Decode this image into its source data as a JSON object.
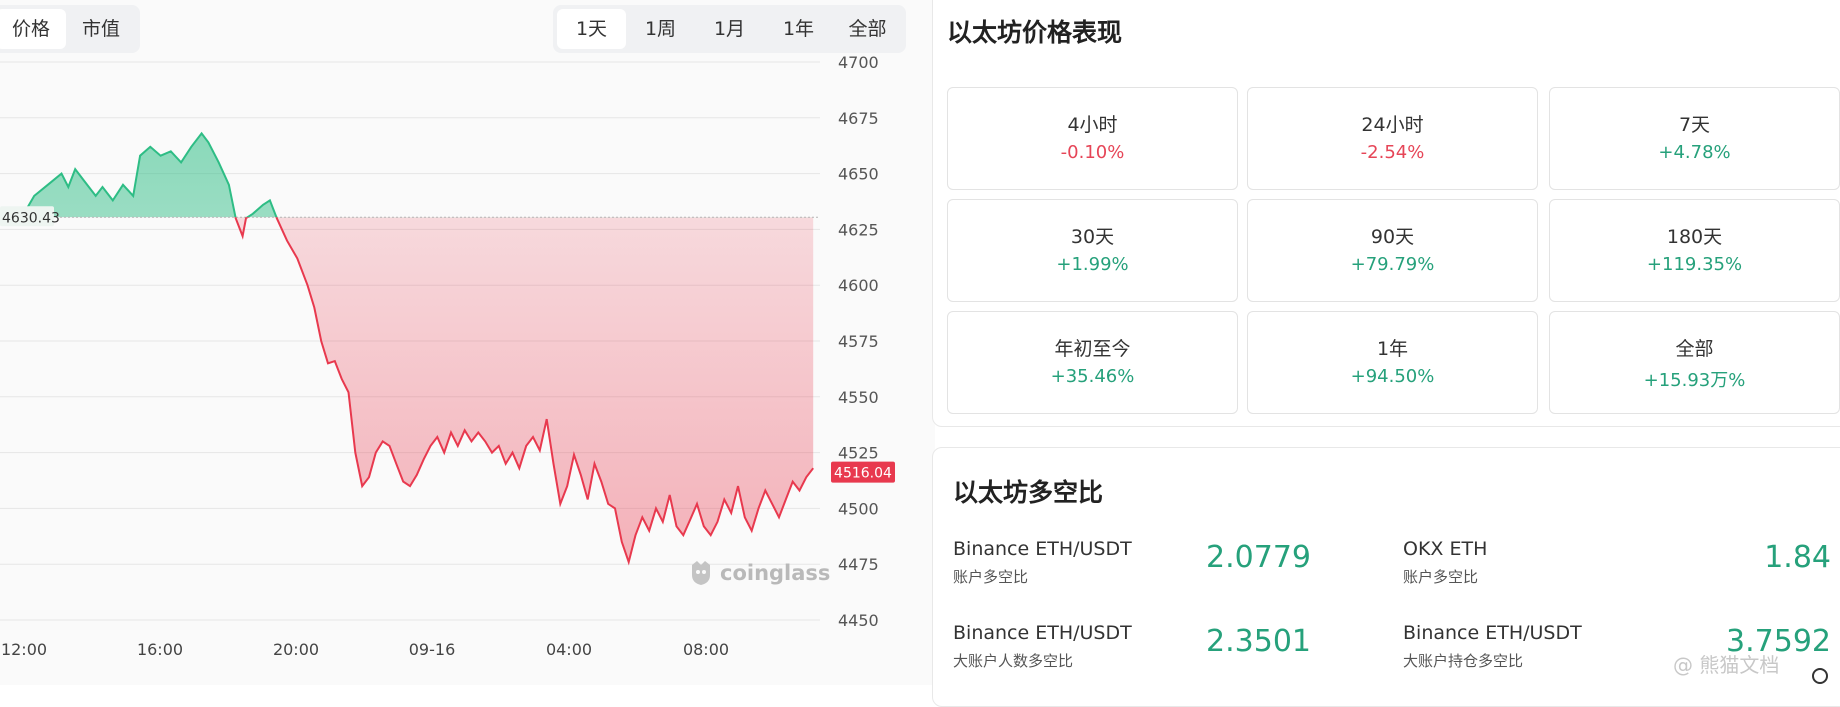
{
  "chart": {
    "metric_tabs": [
      {
        "label": "价格",
        "active": true
      },
      {
        "label": "市值",
        "active": false
      }
    ],
    "range_tabs": [
      {
        "label": "1天",
        "active": true
      },
      {
        "label": "1周",
        "active": false
      },
      {
        "label": "1月",
        "active": false
      },
      {
        "label": "1年",
        "active": false
      },
      {
        "label": "全部",
        "active": false
      }
    ],
    "watermark": "coinglass",
    "colors": {
      "up": "#2ebd85",
      "down": "#e8394e",
      "up_fill": "#bfe9d5",
      "down_fill": "#f2c1c8"
    }
  },
  "chart_data": {
    "type": "area",
    "y_ticks": [
      "4700",
      "4675",
      "4650",
      "4625",
      "4600",
      "4575",
      "4550",
      "4525",
      "4500",
      "4475",
      "4450"
    ],
    "x_ticks": [
      "12:00",
      "16:00",
      "20:00",
      "09-16",
      "04:00",
      "08:00"
    ],
    "ylim": [
      4450,
      4700
    ],
    "baseline_value": 4630.43,
    "baseline_label": "4630.43",
    "last_value": 4516.04,
    "last_label": "4516.04",
    "x_hours": [
      11,
      23
    ],
    "series": [
      {
        "values": [
          [
            11.35,
            4632
          ],
          [
            11.5,
            4640
          ],
          [
            11.7,
            4645
          ],
          [
            11.9,
            4650
          ],
          [
            12.0,
            4644
          ],
          [
            12.1,
            4652
          ],
          [
            12.25,
            4646
          ],
          [
            12.4,
            4640
          ],
          [
            12.5,
            4644
          ],
          [
            12.65,
            4638
          ],
          [
            12.8,
            4645
          ],
          [
            12.95,
            4640
          ],
          [
            13.05,
            4658
          ],
          [
            13.2,
            4662
          ],
          [
            13.35,
            4658
          ],
          [
            13.5,
            4660
          ],
          [
            13.65,
            4655
          ],
          [
            13.8,
            4662
          ],
          [
            13.95,
            4668
          ],
          [
            14.05,
            4664
          ],
          [
            14.2,
            4655
          ],
          [
            14.35,
            4645
          ],
          [
            14.45,
            4630
          ],
          [
            14.55,
            4622
          ],
          [
            14.6,
            4630
          ],
          [
            14.7,
            4632
          ],
          [
            14.85,
            4636
          ],
          [
            14.95,
            4638
          ],
          [
            15.05,
            4630
          ],
          [
            15.2,
            4620
          ],
          [
            15.35,
            4612
          ],
          [
            15.5,
            4600
          ],
          [
            15.6,
            4590
          ],
          [
            15.7,
            4575
          ],
          [
            15.8,
            4565
          ],
          [
            15.9,
            4566
          ],
          [
            16.0,
            4558
          ],
          [
            16.1,
            4552
          ],
          [
            16.2,
            4525
          ],
          [
            16.3,
            4510
          ],
          [
            16.4,
            4514
          ],
          [
            16.5,
            4525
          ],
          [
            16.6,
            4530
          ],
          [
            16.7,
            4528
          ],
          [
            16.8,
            4520
          ],
          [
            16.9,
            4512
          ],
          [
            17.0,
            4510
          ],
          [
            17.1,
            4515
          ],
          [
            17.2,
            4522
          ],
          [
            17.3,
            4528
          ],
          [
            17.4,
            4532
          ],
          [
            17.5,
            4525
          ],
          [
            17.6,
            4534
          ],
          [
            17.7,
            4528
          ],
          [
            17.8,
            4535
          ],
          [
            17.9,
            4530
          ],
          [
            18.0,
            4534
          ],
          [
            18.1,
            4530
          ],
          [
            18.2,
            4525
          ],
          [
            18.3,
            4528
          ],
          [
            18.4,
            4520
          ],
          [
            18.5,
            4525
          ],
          [
            18.6,
            4518
          ],
          [
            18.7,
            4528
          ],
          [
            18.8,
            4532
          ],
          [
            18.9,
            4526
          ],
          [
            19.0,
            4540
          ],
          [
            19.1,
            4520
          ],
          [
            19.2,
            4502
          ],
          [
            19.3,
            4510
          ],
          [
            19.4,
            4524
          ],
          [
            19.5,
            4515
          ],
          [
            19.6,
            4504
          ],
          [
            19.7,
            4520
          ],
          [
            19.8,
            4512
          ],
          [
            19.9,
            4502
          ],
          [
            20.0,
            4500
          ],
          [
            20.1,
            4485
          ],
          [
            20.2,
            4476
          ],
          [
            20.3,
            4488
          ],
          [
            20.4,
            4496
          ],
          [
            20.5,
            4490
          ],
          [
            20.6,
            4500
          ],
          [
            20.7,
            4494
          ],
          [
            20.8,
            4506
          ],
          [
            20.9,
            4492
          ],
          [
            21.0,
            4488
          ],
          [
            21.1,
            4495
          ],
          [
            21.2,
            4502
          ],
          [
            21.3,
            4492
          ],
          [
            21.4,
            4488
          ],
          [
            21.5,
            4494
          ],
          [
            21.6,
            4504
          ],
          [
            21.7,
            4498
          ],
          [
            21.8,
            4510
          ],
          [
            21.9,
            4496
          ],
          [
            22.0,
            4490
          ],
          [
            22.1,
            4500
          ],
          [
            22.2,
            4508
          ],
          [
            22.3,
            4502
          ],
          [
            22.4,
            4496
          ],
          [
            22.5,
            4504
          ],
          [
            22.6,
            4512
          ],
          [
            22.7,
            4508
          ],
          [
            22.8,
            4514
          ],
          [
            22.9,
            4518
          ]
        ]
      }
    ]
  },
  "performance": {
    "title": "以太坊价格表现",
    "tiles": [
      {
        "label": "4小时",
        "value": "-0.10%",
        "trend": "neg"
      },
      {
        "label": "24小时",
        "value": "-2.54%",
        "trend": "neg"
      },
      {
        "label": "7天",
        "value": "+4.78%",
        "trend": "pos"
      },
      {
        "label": "30天",
        "value": "+1.99%",
        "trend": "pos"
      },
      {
        "label": "90天",
        "value": "+79.79%",
        "trend": "pos"
      },
      {
        "label": "180天",
        "value": "+119.35%",
        "trend": "pos"
      },
      {
        "label": "年初至今",
        "value": "+35.46%",
        "trend": "pos"
      },
      {
        "label": "1年",
        "value": "+94.50%",
        "trend": "pos"
      },
      {
        "label": "全部",
        "value": "+15.93万%",
        "trend": "pos"
      }
    ]
  },
  "long_short": {
    "title": "以太坊多空比",
    "items": [
      {
        "name": "Binance ETH/USDT",
        "sub": "账户多空比",
        "value": "2.0779"
      },
      {
        "name": "OKX ETH",
        "sub": "账户多空比",
        "value": "1.84"
      },
      {
        "name": "Binance ETH/USDT",
        "sub": "大账户人数多空比",
        "value": "2.3501"
      },
      {
        "name": "Binance ETH/USDT",
        "sub": "大账户持仓多空比",
        "value": "3.7592"
      }
    ]
  },
  "corner_watermark": "@ 熊猫文档"
}
